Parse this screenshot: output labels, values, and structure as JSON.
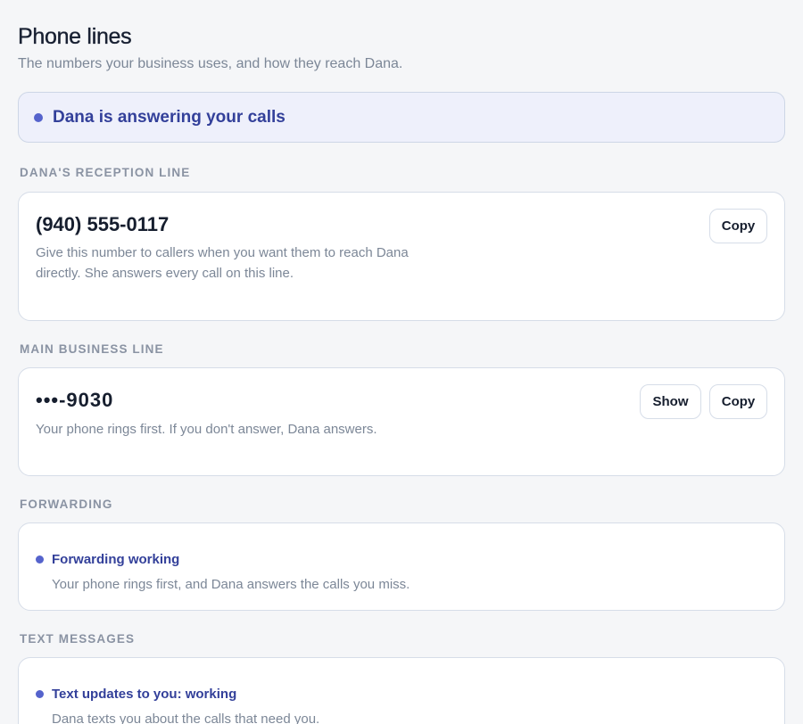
{
  "header": {
    "title": "Phone lines",
    "subtitle": "The numbers your business uses, and how they reach Dana."
  },
  "banner": {
    "text": "Dana is answering your calls"
  },
  "reception": {
    "label": "DANA'S RECEPTION LINE",
    "number": "(940) 555-0117",
    "description": "Give this number to callers when you want them to reach Dana directly. She answers every call on this line.",
    "copy_label": "Copy"
  },
  "main_line": {
    "label": "MAIN BUSINESS LINE",
    "number": "•••-9030",
    "description": "Your phone rings first. If you don't answer, Dana answers.",
    "show_label": "Show",
    "copy_label": "Copy"
  },
  "forwarding": {
    "label": "FORWARDING",
    "status": "Forwarding working",
    "description": "Your phone rings first, and Dana answers the calls you miss."
  },
  "text_messages": {
    "label": "TEXT MESSAGES",
    "status": "Text updates to you: working",
    "description": "Dana texts you about the calls that need you."
  },
  "colors": {
    "accent": "#5563cc",
    "accent_text": "#33409a",
    "banner_bg": "#eef0fb",
    "muted_text": "#7c8797"
  }
}
